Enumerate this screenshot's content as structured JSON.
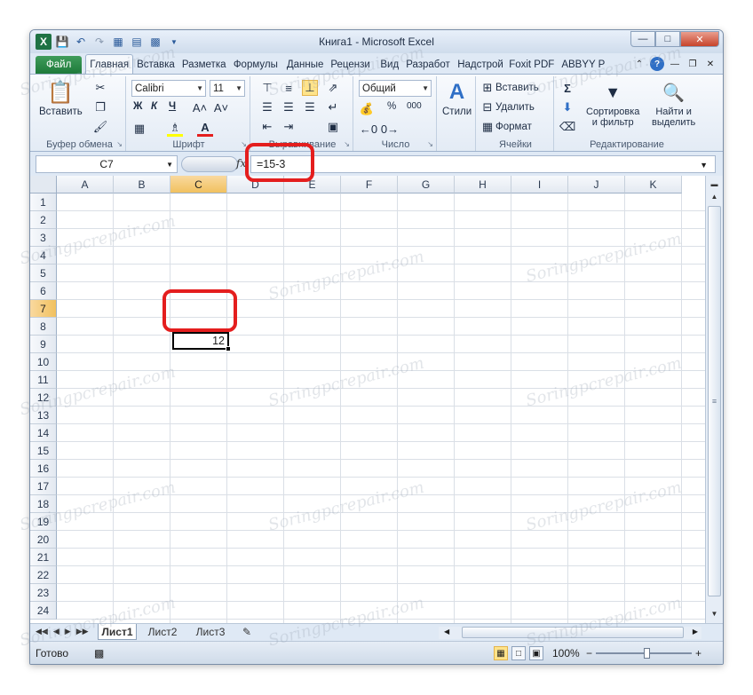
{
  "window": {
    "title": "Книга1  -  Microsoft Excel"
  },
  "tabs": [
    {
      "label": "Файл"
    },
    {
      "label": "Главная"
    },
    {
      "label": "Вставка"
    },
    {
      "label": "Разметка"
    },
    {
      "label": "Формулы"
    },
    {
      "label": "Данные"
    },
    {
      "label": "Рецензи"
    },
    {
      "label": "Вид"
    },
    {
      "label": "Разработ"
    },
    {
      "label": "Надстрой"
    },
    {
      "label": "Foxit PDF"
    },
    {
      "label": "ABBYY PD"
    }
  ],
  "ribbon": {
    "clipboard": {
      "paste_label": "Вставить",
      "group_label": "Буфер обмена"
    },
    "font": {
      "family": "Calibri",
      "size": "11",
      "bold": "Ж",
      "italic": "К",
      "underline": "Ч",
      "group_label": "Шрифт"
    },
    "alignment": {
      "group_label": "Выравнивание"
    },
    "number": {
      "format": "Общий",
      "percent": "%",
      "thousands": "000",
      "group_label": "Число"
    },
    "styles": {
      "label": "Стили"
    },
    "cells": {
      "insert": "Вставить",
      "delete": "Удалить",
      "format": "Формат",
      "group_label": "Ячейки"
    },
    "editing": {
      "sort": "Сортировка",
      "sort2": "и фильтр",
      "find": "Найти и",
      "find2": "выделить",
      "group_label": "Редактирование"
    }
  },
  "formula_bar": {
    "name_box": "C7",
    "fx": "fx",
    "formula": "=15-3"
  },
  "grid": {
    "columns": [
      "A",
      "B",
      "C",
      "D",
      "E",
      "F",
      "G",
      "H",
      "I",
      "J",
      "K"
    ],
    "rows": [
      "1",
      "2",
      "3",
      "4",
      "5",
      "6",
      "7",
      "8",
      "9",
      "10",
      "11",
      "12",
      "13",
      "14",
      "15",
      "16",
      "17",
      "18",
      "19",
      "20",
      "21",
      "22",
      "23",
      "24"
    ],
    "selected_column": "C",
    "selected_row": "7",
    "active_cell_value": "12"
  },
  "sheets": [
    {
      "label": "Лист1"
    },
    {
      "label": "Лист2"
    },
    {
      "label": "Лист3"
    }
  ],
  "status": {
    "ready": "Готово",
    "zoom": "100%",
    "minus": "−",
    "plus": "+"
  },
  "watermark": "Soringpcrepair.com",
  "colors": {
    "highlight": "#e41e1e",
    "selected_header": "#f1c15f",
    "file_tab": "#1e7a3a"
  }
}
